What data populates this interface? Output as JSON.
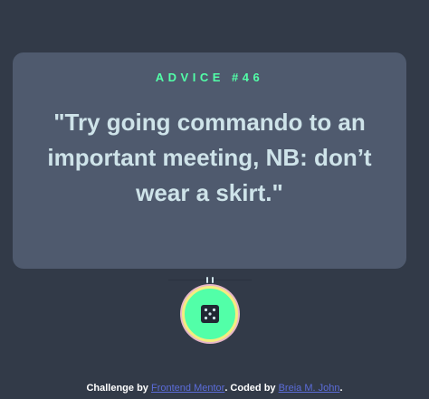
{
  "advice": {
    "id_label": "ADVICE #46",
    "quote": "\"Try going commando to an important meeting, NB: don’t wear a skirt.\""
  },
  "dice": {
    "icon": "dice-icon"
  },
  "footer": {
    "prefix": "Challenge by ",
    "challenge_link": "Frontend Mentor",
    "middle": ". Coded by ",
    "author_link": "Breia M. John",
    "suffix": "."
  },
  "colors": {
    "background": "#323a48",
    "card": "#4f5a6e",
    "accent": "#52ffa8",
    "text": "#cee3e9",
    "link": "#5b6cd9"
  }
}
